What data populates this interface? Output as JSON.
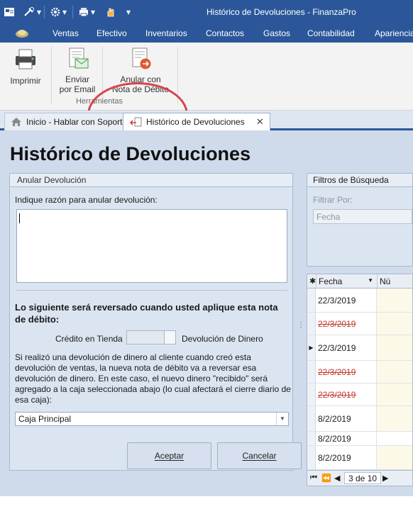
{
  "window": {
    "title": "Histórico de Devoluciones - FinanzaPro"
  },
  "quick_access": [
    {
      "icon": "app-logo-icon"
    },
    {
      "icon": "tools-icon"
    },
    {
      "icon": "gear-icon"
    },
    {
      "icon": "print-preview-icon"
    },
    {
      "icon": "hand-icon"
    },
    {
      "icon": "customize-dropdown-icon"
    }
  ],
  "menu": {
    "items": [
      "Ventas",
      "Efectivo",
      "Inventarios",
      "Contactos",
      "Gastos",
      "Contabilidad",
      "Apariencia"
    ]
  },
  "ribbon": {
    "print_label": "Imprimir",
    "email_label": "Enviar\npor Email",
    "cancel_debit_label": "Anular con\nNota de Débito",
    "group_label": "Herramientas"
  },
  "tabs": [
    {
      "label": "Inicio - Hablar con Soporte",
      "icon": "home-icon",
      "active": false
    },
    {
      "label": "Histórico de Devoluciones",
      "icon": "return-icon",
      "active": true,
      "close": "✕"
    }
  ],
  "page": {
    "title": "Histórico de Devoluciones"
  },
  "cancel_panel": {
    "header": "Anular Devolución",
    "prompt": "Indique razón para anular devolución:",
    "reason_value": "",
    "bold_note": "Lo siguiente será reversado cuando usted aplique esta nota de débito:",
    "toggle_left": "Crédito en Tienda",
    "toggle_right": "Devolución de Dinero",
    "info": "Si realizó una devolución de dinero al cliente cuando creó esta devolución de ventas, la nueva nota de débito va a reversar esa devolución de dinero. En este caso, el nuevo dinero \"recibido\" será agregado a la caja seleccionada abajo (lo cual afectará el cierre diario de esa caja):",
    "cash_register": "Caja Principal",
    "accept_label": "Aceptar",
    "cancel_label": "Cancelar"
  },
  "filters": {
    "header": "Filtros de Búsqueda",
    "filter_by_label": "Filtrar Por:",
    "filter_by_value": "Fecha"
  },
  "grid": {
    "columns": [
      "Fecha",
      "Nú"
    ],
    "rows": [
      {
        "date": "22/3/2019",
        "voided": false,
        "current": false
      },
      {
        "date": "22/3/2019",
        "voided": true,
        "current": false
      },
      {
        "date": "22/3/2019",
        "voided": false,
        "current": true
      },
      {
        "date": "22/3/2019",
        "voided": true,
        "current": false
      },
      {
        "date": "22/3/2019",
        "voided": true,
        "current": false
      },
      {
        "date": "8/2/2019",
        "voided": false,
        "current": false
      },
      {
        "date": "8/2/2019",
        "voided": false,
        "current": false
      },
      {
        "date": "8/2/2019",
        "voided": false,
        "current": false
      }
    ],
    "pager": {
      "current": "3 de 10"
    }
  },
  "colors": {
    "titlebar": "#2b579a",
    "highlight_circle": "#d9434a",
    "voided_text": "#c0392b"
  }
}
